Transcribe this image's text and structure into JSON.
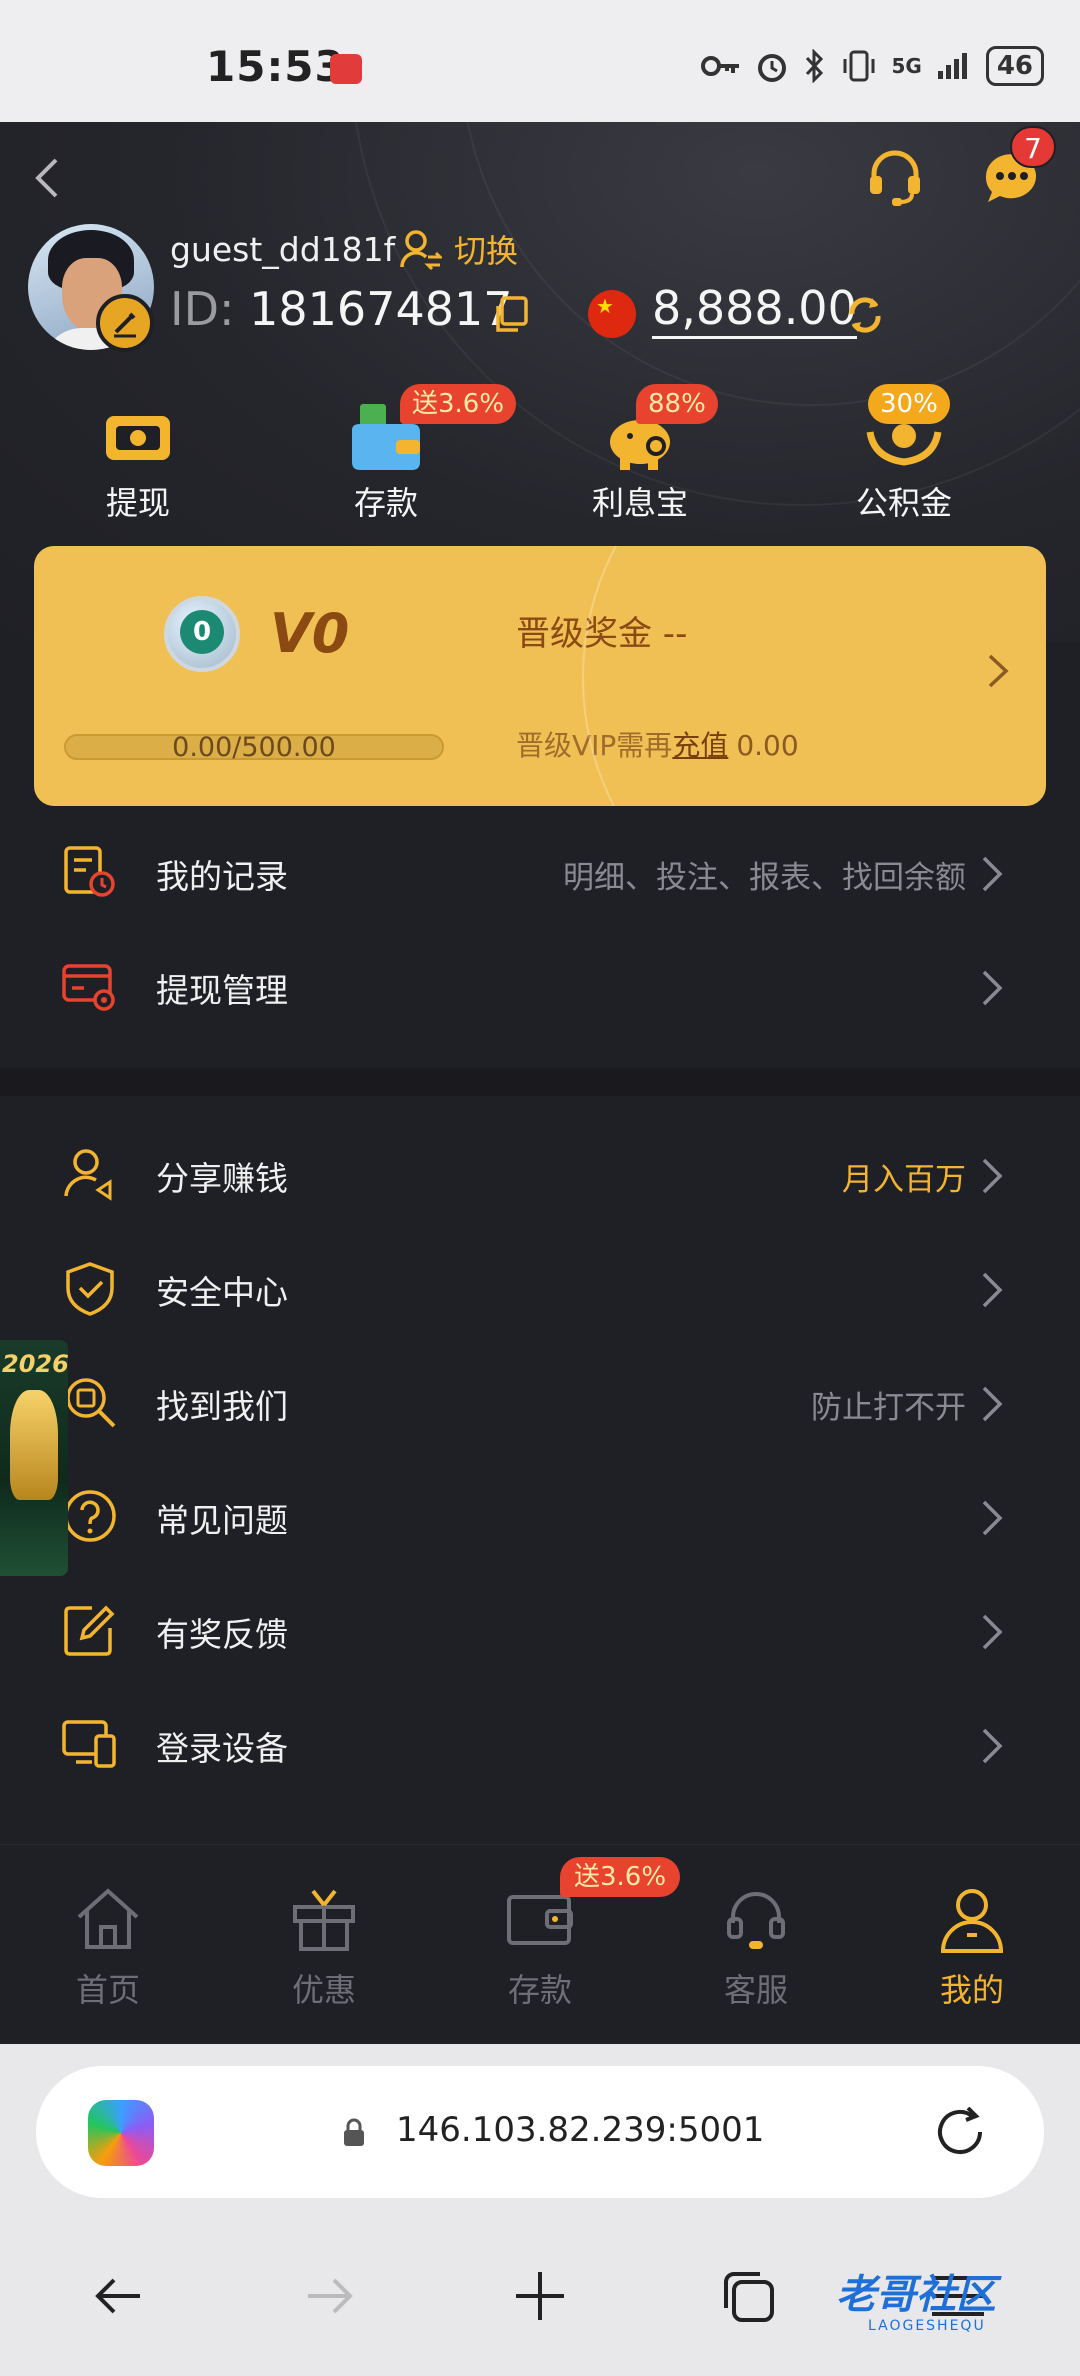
{
  "status_bar": {
    "time": "15:53",
    "network": "5G",
    "battery": "46"
  },
  "header": {
    "username": "guest_dd181f",
    "switch_label": "切换",
    "id_prefix": "ID:",
    "id_value": "181674817",
    "balance": "8,888.00",
    "message_count": "7"
  },
  "quick_actions": [
    {
      "label": "提现",
      "icon": "withdraw-icon",
      "promo": ""
    },
    {
      "label": "存款",
      "icon": "wallet-icon",
      "promo": "送3.6%"
    },
    {
      "label": "利息宝",
      "icon": "piggy-bank-icon",
      "promo": "88%"
    },
    {
      "label": "公积金",
      "icon": "fund-hands-icon",
      "promo": "30%"
    }
  ],
  "vip": {
    "badge_number": "0",
    "level": "V0",
    "bonus_label": "晋级奖金 --",
    "progress_text": "0.00/500.00",
    "progress_fraction": 0,
    "need_prefix": "晋级VIP需再",
    "need_link": "充值",
    "need_amount": "0.00"
  },
  "menu_group1": [
    {
      "label": "我的记录",
      "right": "明细、投注、报表、找回余额",
      "icon": "records-icon"
    },
    {
      "label": "提现管理",
      "right": "",
      "icon": "withdraw-manage-icon"
    }
  ],
  "menu_group2": [
    {
      "label": "分享赚钱",
      "right": "月入百万",
      "icon": "share-user-icon"
    },
    {
      "label": "安全中心",
      "right": "",
      "icon": "shield-check-icon"
    },
    {
      "label": "找到我们",
      "right": "防止打不开",
      "icon": "search-doc-icon"
    },
    {
      "label": "常见问题",
      "right": "",
      "icon": "question-icon"
    },
    {
      "label": "有奖反馈",
      "right": "",
      "icon": "edit-feedback-icon"
    },
    {
      "label": "登录设备",
      "right": "",
      "icon": "devices-icon"
    }
  ],
  "side_banner": {
    "year": "2026"
  },
  "tabs": [
    {
      "label": "首页",
      "icon": "home-icon"
    },
    {
      "label": "优惠",
      "icon": "gift-icon"
    },
    {
      "label": "存款",
      "icon": "wallet-icon"
    },
    {
      "label": "客服",
      "icon": "headset-icon"
    },
    {
      "label": "我的",
      "icon": "user-icon"
    }
  ],
  "tab_promo": "送3.6%",
  "browser": {
    "url": "146.103.82.239:5001"
  },
  "watermark": {
    "title": "老哥社区",
    "sub": "LAOGESHEQU"
  },
  "colors": {
    "accent": "#f3b530",
    "background": "#1f2026",
    "vip_card": "#f1c055",
    "promo_red": "#e8432e"
  }
}
